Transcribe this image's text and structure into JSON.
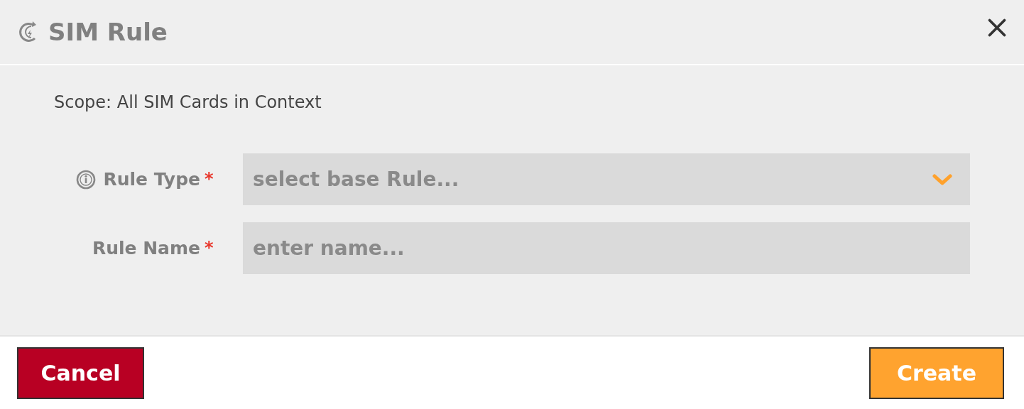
{
  "dialog": {
    "title": "SIM Rule"
  },
  "scope": "Scope: All SIM Cards in Context",
  "fields": [
    {
      "kind": "select",
      "label": "Rule Type",
      "required_mark": "*",
      "info": true,
      "placeholder": "select base Rule..."
    },
    {
      "kind": "text",
      "label": "Rule Name",
      "required_mark": "*",
      "info": false,
      "placeholder": "enter name..."
    }
  ],
  "buttons": [
    {
      "kind": "cancel",
      "label": "Cancel"
    },
    {
      "kind": "primary",
      "label": "Create"
    }
  ]
}
